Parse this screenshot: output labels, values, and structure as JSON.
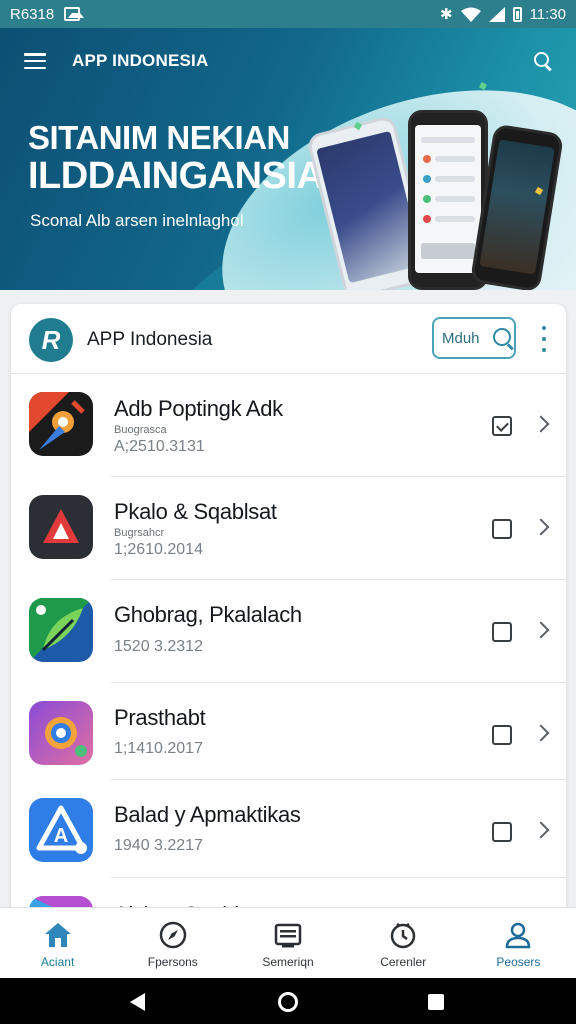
{
  "status_bar": {
    "left_text": "R6318",
    "time": "11:30",
    "icons": [
      "image-icon",
      "bluetooth-icon",
      "wifi-icon",
      "signal-icon",
      "battery-icon"
    ]
  },
  "hero": {
    "app_title": "APP INDONESIA",
    "headline_line1": "SITANIM NEKIAN",
    "headline_line2": "ILDDAINGANSIAA",
    "subline": "Sconal Alb arsen inelnlaghol"
  },
  "card": {
    "title": "APP Indonesia",
    "search_text": "Mduh",
    "items": [
      {
        "title": "Adb Poptingk Adk",
        "sub": "Buograsca",
        "meta": "A;2510.3131",
        "checked": true,
        "icon": "brush-app-icon",
        "colors": [
          "#e2492e",
          "#1b1b1b"
        ]
      },
      {
        "title": "Pkalo & Sqablsat",
        "sub": "Bugrsahcr",
        "meta": "1;2610.2014",
        "checked": false,
        "icon": "triangle-app-icon",
        "colors": [
          "#2b2f35",
          "#e23a3a"
        ]
      },
      {
        "title": "Ghobrag, Pkalalach",
        "sub": "",
        "meta": "1520 3.2312",
        "checked": false,
        "icon": "leaf-app-icon",
        "colors": [
          "#1e9a4a",
          "#1d5aa8"
        ]
      },
      {
        "title": "Prasthabt",
        "sub": "",
        "meta": "1;1410.2017",
        "checked": false,
        "icon": "lens-app-icon",
        "colors": [
          "#8a4bd6",
          "#e06fa3"
        ]
      },
      {
        "title": "Balad y Apmaktikas",
        "sub": "",
        "meta": "1940 3.2217",
        "checked": false,
        "icon": "a-logo-app-icon",
        "colors": [
          "#2f7ee8",
          "#ffffff"
        ]
      },
      {
        "title": "Alcken Saubl",
        "sub": "",
        "meta": "",
        "checked": false,
        "icon": "partial-app-icon",
        "colors": [
          "#37a3e6",
          "#b64fd1"
        ]
      }
    ]
  },
  "bottom_nav": [
    {
      "label": "Aciant",
      "icon": "home-icon",
      "active": true
    },
    {
      "label": "Fpersons",
      "icon": "compass-icon",
      "active": false
    },
    {
      "label": "Semeriqn",
      "icon": "news-icon",
      "active": false
    },
    {
      "label": "Cerenler",
      "icon": "clock-icon",
      "active": false
    },
    {
      "label": "Peosers",
      "icon": "person-icon",
      "active": false
    }
  ],
  "theme": {
    "accent": "#1f7d8f",
    "status_bar_bg": "#2e7f8e",
    "nav_active": "#1f7d99"
  }
}
